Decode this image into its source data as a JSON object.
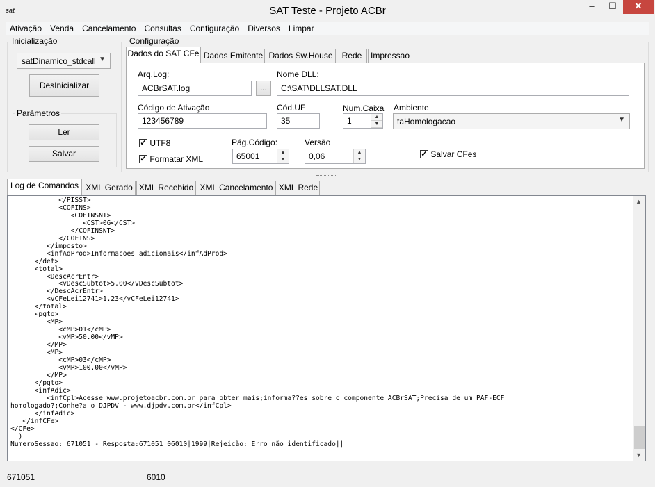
{
  "window": {
    "title": "SAT Teste - Projeto ACBr",
    "icon_text": "sat",
    "minimize": "–",
    "maximize": "☐",
    "close": "✕"
  },
  "menu": [
    "Ativação",
    "Venda",
    "Cancelamento",
    "Consultas",
    "Configuração",
    "Diversos",
    "Limpar"
  ],
  "inicializacao": {
    "label": "Inicialização",
    "lib_combo": "satDinamico_stdcall",
    "desinicializar_button": "DesInicializar",
    "parametros_label": "Parâmetros",
    "ler_button": "Ler",
    "salvar_button": "Salvar"
  },
  "configuracao": {
    "label": "Configuração",
    "tabs": [
      "Dados do SAT CFe",
      "Dados Emitente",
      "Dados Sw.House",
      "Rede",
      "Impressao"
    ],
    "arqlog_label": "Arq.Log:",
    "arqlog_value": "ACBrSAT.log",
    "browse_button": "...",
    "nomedll_label": "Nome DLL:",
    "nomedll_value": "C:\\SAT\\DLLSAT.DLL",
    "codativ_label": "Código de Ativação",
    "codativ_value": "123456789",
    "coduf_label": "Cód.UF",
    "coduf_value": "35",
    "numcaixa_label": "Num.Caixa",
    "numcaixa_value": "1",
    "ambiente_label": "Ambiente",
    "ambiente_value": "taHomologacao",
    "utf8_label": "UTF8",
    "utf8_checked": true,
    "formatar_label": "Formatar XML",
    "formatar_checked": true,
    "pagcodigo_label": "Pág.Código:",
    "pagcodigo_value": "65001",
    "versao_label": "Versão",
    "versao_value": "0,06",
    "salvarcfes_label": "Salvar CFes",
    "salvarcfes_checked": true,
    "checkmark": "✓"
  },
  "log_tabs": [
    "Log de Comandos",
    "XML Gerado",
    "XML Recebido",
    "XML Cancelamento",
    "XML Rede"
  ],
  "log_text": "            </PISST>\n            <COFINS>\n               <COFINSNT>\n                  <CST>06</CST>\n               </COFINSNT>\n            </COFINS>\n         </imposto>\n         <infAdProd>Informacoes adicionais</infAdProd>\n      </det>\n      <total>\n         <DescAcrEntr>\n            <vDescSubtot>5.00</vDescSubtot>\n         </DescAcrEntr>\n         <vCFeLei12741>1.23</vCFeLei12741>\n      </total>\n      <pgto>\n         <MP>\n            <cMP>01</cMP>\n            <vMP>50.00</vMP>\n         </MP>\n         <MP>\n            <cMP>03</cMP>\n            <vMP>100.00</vMP>\n         </MP>\n      </pgto>\n      <infAdic>\n         <infCpl>Acesse www.projetoacbr.com.br para obter mais;informa??es sobre o componente ACBrSAT;Precisa de um PAF-ECF\nhomologado?;Conhe?a o DJPDV - www.djpdv.com.br</infCpl>\n      </infAdic>\n   </infCFe>\n</CFe>\n  )\nNumeroSessao: 671051 - Resposta:671051|06010|1999|Rejeição: Erro não identificado||",
  "status": {
    "sessao": "671051",
    "codigo": "6010"
  }
}
